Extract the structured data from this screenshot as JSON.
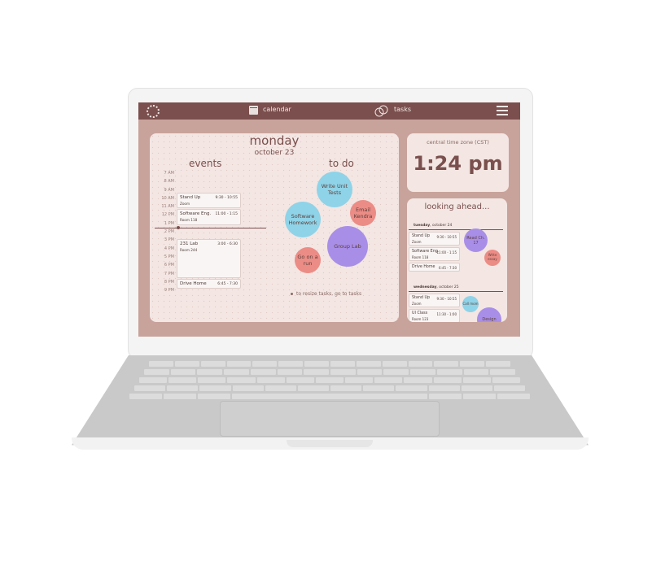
{
  "topbar": {
    "calendar_label": "calendar",
    "tasks_label": "tasks"
  },
  "day": {
    "name": "monday",
    "date": "october 23",
    "events_title": "events",
    "todo_title": "to do",
    "hint": "to resize tasks, go to tasks"
  },
  "times": [
    "7 AM",
    "8 AM",
    "9 AM",
    "10 AM",
    "11 AM",
    "12 PM",
    "1 PM",
    "2 PM",
    "3 PM",
    "4 PM",
    "5 PM",
    "6 PM",
    "7 PM",
    "8 PM",
    "9 PM"
  ],
  "events": [
    {
      "name": "Stand Up",
      "time": "9:30 - 10:55",
      "location": "Zoom"
    },
    {
      "name": "Software Eng.",
      "time": "11:00 - 1:15",
      "location": "Room 118"
    },
    {
      "name": "231 Lab",
      "time": "3:00 - 6:30",
      "location": "Room 244"
    },
    {
      "name": "Drive Home",
      "time": "6:45 - 7:30",
      "location": ""
    }
  ],
  "todos": [
    {
      "label": "Write Unit Tests",
      "color": "#8fd3e8"
    },
    {
      "label": "Email Kendra",
      "color": "#ec8c86"
    },
    {
      "label": "Software Homework",
      "color": "#8fd3e8"
    },
    {
      "label": "Group Lab",
      "color": "#a98ee8"
    },
    {
      "label": "Go on a run",
      "color": "#ec8c86"
    }
  ],
  "clock": {
    "timezone": "central time zone (CST)",
    "time": "1:24 pm"
  },
  "ahead": {
    "title": "looking ahead...",
    "days": [
      {
        "weekday": "tuesday",
        "date": ", october 24",
        "events": [
          {
            "name": "Stand Up",
            "time": "9:30 - 10:55",
            "location": "Zoom"
          },
          {
            "name": "Software Eng.",
            "time": "11:00 - 1:15",
            "location": "Room 118"
          },
          {
            "name": "Drive Home",
            "time": "6:45 - 7:30",
            "location": ""
          }
        ],
        "tasks": [
          {
            "label": "Read Ch. 17",
            "color": "#a98ee8"
          },
          {
            "label": "Write essay",
            "color": "#ec8c86"
          }
        ]
      },
      {
        "weekday": "wednesday",
        "date": ", october 25",
        "events": [
          {
            "name": "Stand Up",
            "time": "9:30 - 10:55",
            "location": "Zoom"
          },
          {
            "name": "UI Class",
            "time": "11:30 - 1:00",
            "location": "Room 123"
          }
        ],
        "tasks": [
          {
            "label": "Call mom",
            "color": "#8fd3e8"
          },
          {
            "label": "Design",
            "color": "#a98ee8"
          }
        ]
      }
    ]
  },
  "colors": {
    "topbar": "#7a4f4d",
    "screen_bg": "#c8a39b",
    "panel_bg": "#f3e6e3",
    "accent_text": "#7a4f4d"
  }
}
